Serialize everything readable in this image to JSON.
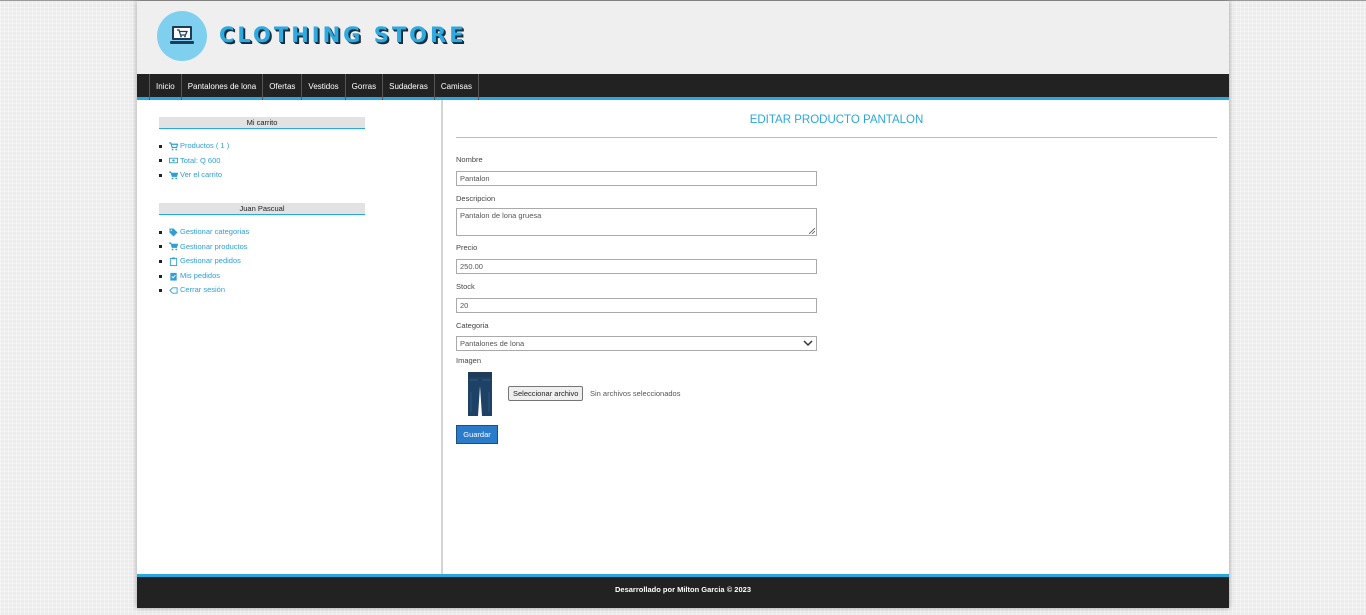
{
  "header": {
    "brand": "CLOTHING STORE",
    "logo_icon": "laptop-cart-icon"
  },
  "nav": {
    "items": [
      "Inicio",
      "Pantalones de lona",
      "Ofertas",
      "Vestidos",
      "Gorras",
      "Sudaderas",
      "Camisas"
    ]
  },
  "sidebar": {
    "cart": {
      "title": "Mi carrito",
      "items": [
        {
          "label": "Productos ( 1 )",
          "icon": "cart-icon"
        },
        {
          "label": "Total: Q 600",
          "icon": "money-icon"
        },
        {
          "label": "Ver el carrito",
          "icon": "cart-icon"
        }
      ]
    },
    "user": {
      "title": "Juan Pascual",
      "items": [
        {
          "label": "Gestionar categorias",
          "icon": "tag-icon"
        },
        {
          "label": "Gestionar productos",
          "icon": "cart-icon"
        },
        {
          "label": "Gestionar pedidos",
          "icon": "clipboard-icon"
        },
        {
          "label": "Mis pedidos",
          "icon": "order-icon"
        },
        {
          "label": "Cerrar sesión",
          "icon": "logout-icon"
        }
      ]
    }
  },
  "main": {
    "title": "EDITAR PRODUCTO PANTALON",
    "form": {
      "nombre_label": "Nombre",
      "nombre_value": "Pantalon",
      "descripcion_label": "Descripcion",
      "descripcion_value": "Pantalon de lona gruesa",
      "precio_label": "Precio",
      "precio_value": "250.00",
      "stock_label": "Stock",
      "stock_value": "20",
      "categoria_label": "Categoria",
      "categoria_value": "Pantalones de lona",
      "imagen_label": "Imagen",
      "file_button": "Seleccionar archivo",
      "file_status": "Sin archivos seleccionados",
      "submit": "Guardar"
    }
  },
  "footer": {
    "text": "Desarrollado por Milton Garcia © 2023"
  },
  "colors": {
    "accent": "#29a8df",
    "button": "#2a7ccb",
    "dark": "#222222"
  }
}
